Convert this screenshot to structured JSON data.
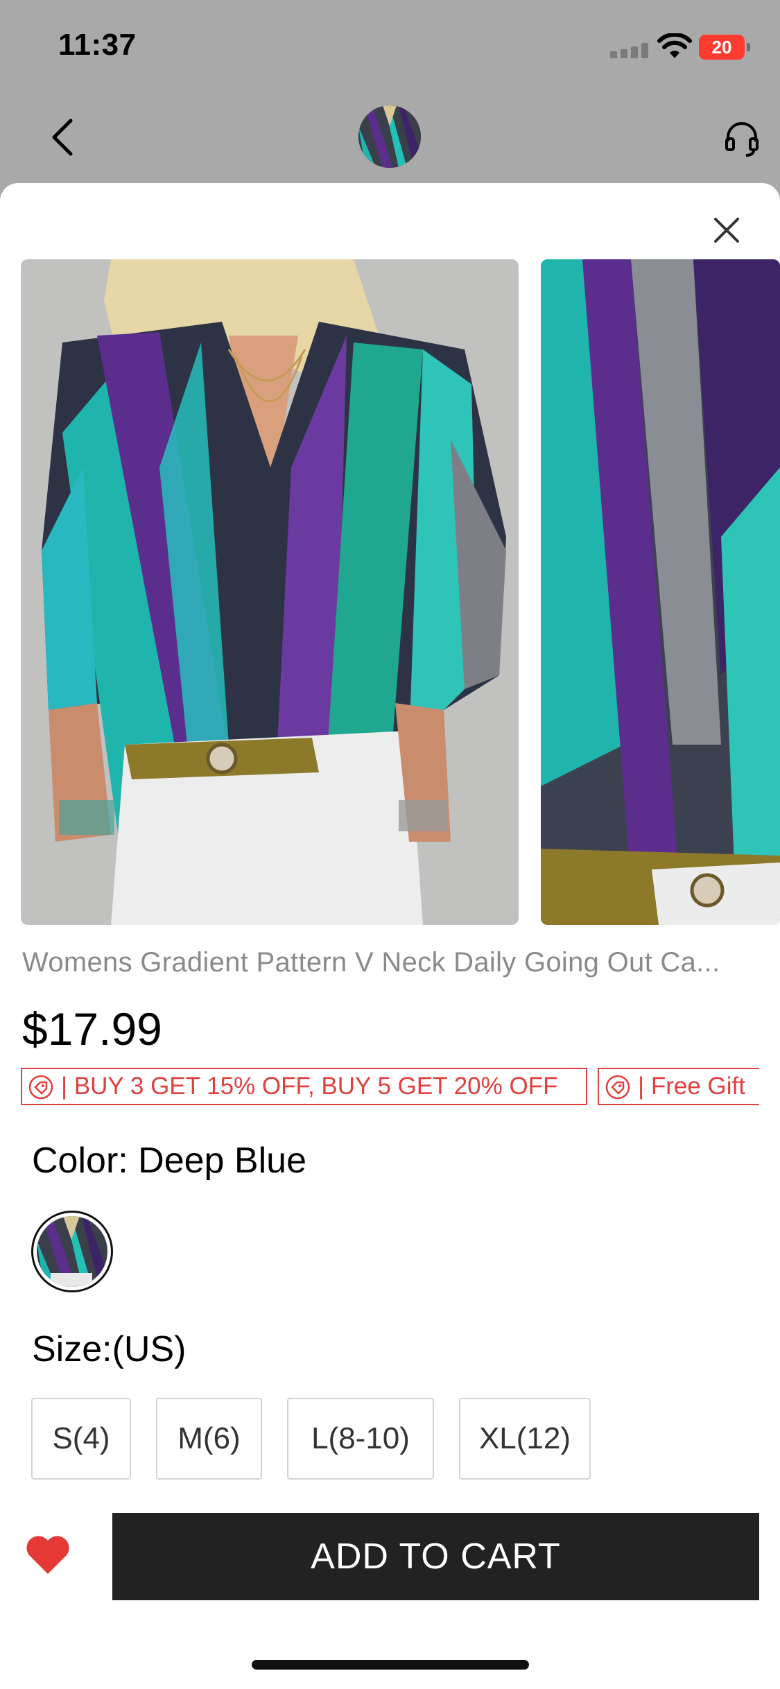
{
  "status_bar": {
    "time": "11:37",
    "battery_level": "20",
    "icons": [
      "signal-icon",
      "wifi-icon",
      "battery-charging-icon"
    ]
  },
  "nav": {
    "back_icon": "chevron-left-icon",
    "support_icon": "headset-icon",
    "avatar": "product-thumbnail"
  },
  "sheet": {
    "close_icon": "close-icon",
    "product_title": "Womens Gradient Pattern V Neck Daily Going Out Ca...",
    "price": "$17.99",
    "promos": [
      {
        "icon": "tag-icon",
        "label": "| BUY 3 GET 15% OFF, BUY 5 GET 20% OFF"
      },
      {
        "icon": "tag-icon",
        "label": "| Free Gift"
      }
    ],
    "color_label": "Color: Deep Blue",
    "size_label": "Size:(US)",
    "sizes": [
      "S(4)",
      "M(6)",
      "L(8-10)",
      "XL(12)"
    ],
    "favorite_icon": "heart-icon",
    "add_to_cart": "ADD TO CART"
  },
  "colors": {
    "accent_red": "#e0403e",
    "button_dark": "#222222",
    "overlay_gray": "#a9a9a9"
  }
}
